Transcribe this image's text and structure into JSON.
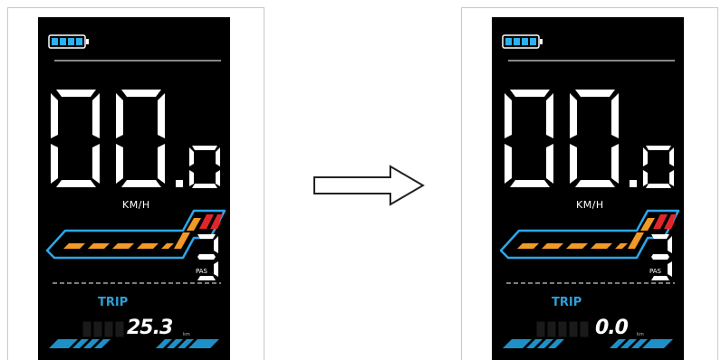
{
  "panels": [
    {
      "id": "before",
      "battery_segments_filled": 4,
      "speed_integer": "00",
      "speed_decimal": "0",
      "speed_unit": "KM/H",
      "pas_level": "3",
      "pas_label": "PAS",
      "mode_label": "TRIP",
      "trip_value": "25.3",
      "trip_unit": "km"
    },
    {
      "id": "after",
      "battery_segments_filled": 4,
      "speed_integer": "00",
      "speed_decimal": "0",
      "speed_unit": "KM/H",
      "pas_level": "3",
      "pas_label": "PAS",
      "mode_label": "TRIP",
      "trip_value": "0.0",
      "trip_unit": "km"
    }
  ],
  "arrow_icon": "right-arrow-icon",
  "colors": {
    "screen_bg": "#000000",
    "battery": "#2bb1ee",
    "power_outline": "#2ea6e8",
    "power_orange": "#f19a28",
    "power_red": "#e1262b",
    "trip_label": "#2f9fd6",
    "bottom_bar": "#1f8fc8",
    "digits": "#ffffff"
  }
}
